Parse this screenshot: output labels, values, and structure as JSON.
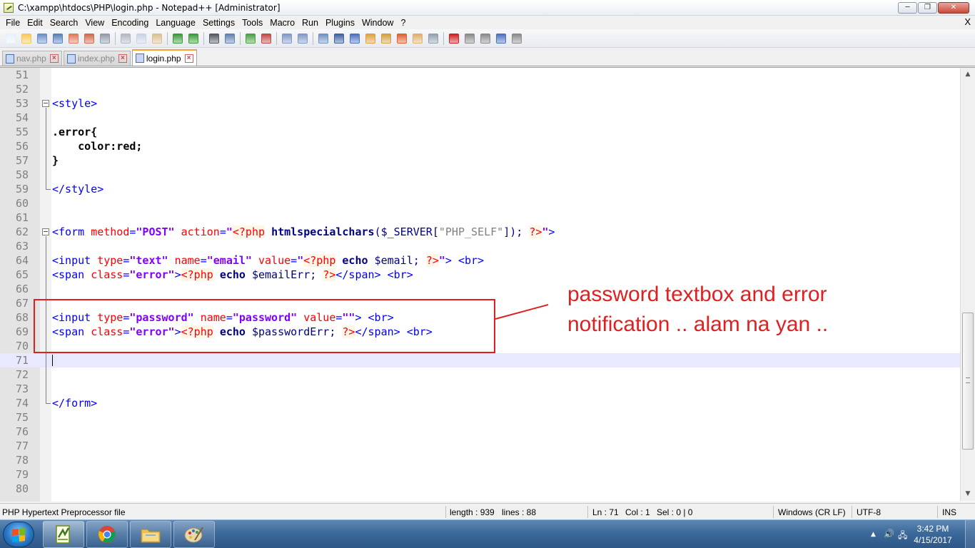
{
  "window": {
    "title": "C:\\xampp\\htdocs\\PHP\\login.php - Notepad++ [Administrator]",
    "min_glyph": "─",
    "max_glyph": "❐",
    "close_glyph": "✕"
  },
  "menu": {
    "items": [
      "File",
      "Edit",
      "Search",
      "View",
      "Encoding",
      "Language",
      "Settings",
      "Tools",
      "Macro",
      "Run",
      "Plugins",
      "Window",
      "?"
    ],
    "close_x": "X"
  },
  "toolbar": {
    "buttons": [
      {
        "name": "new-file-icon",
        "color": "#e8f0ff"
      },
      {
        "name": "open-file-icon",
        "color": "#f6c85a"
      },
      {
        "name": "save-icon",
        "color": "#6a8fc8"
      },
      {
        "name": "save-all-icon",
        "color": "#5a7fb8"
      },
      {
        "name": "close-file-icon",
        "color": "#e07a5a"
      },
      {
        "name": "close-all-icon",
        "color": "#d06a4a"
      },
      {
        "name": "print-icon",
        "color": "#909aa8"
      },
      {
        "sep": true
      },
      {
        "name": "cut-icon",
        "color": "#b0b8c4"
      },
      {
        "name": "copy-icon",
        "color": "#c8d4e4"
      },
      {
        "name": "paste-icon",
        "color": "#d8c090"
      },
      {
        "sep": true
      },
      {
        "name": "undo-icon",
        "color": "#3a9a3a"
      },
      {
        "name": "redo-icon",
        "color": "#3a9a3a"
      },
      {
        "sep": true
      },
      {
        "name": "find-icon",
        "color": "#505860"
      },
      {
        "name": "replace-icon",
        "color": "#6080b0"
      },
      {
        "sep": true
      },
      {
        "name": "zoom-in-icon",
        "color": "#48a048"
      },
      {
        "name": "zoom-out-icon",
        "color": "#c04848"
      },
      {
        "sep": true
      },
      {
        "name": "sync-vertical-icon",
        "color": "#8098c8"
      },
      {
        "name": "sync-horizontal-icon",
        "color": "#8098c8"
      },
      {
        "sep": true
      },
      {
        "name": "word-wrap-icon",
        "color": "#7090c0"
      },
      {
        "name": "show-all-chars-icon",
        "color": "#4060a0"
      },
      {
        "name": "indent-guide-icon",
        "color": "#4a70c0"
      },
      {
        "name": "udl-icon",
        "color": "#e0a040"
      },
      {
        "name": "doc-map-icon",
        "color": "#d0a040"
      },
      {
        "name": "function-list-icon",
        "color": "#e06030"
      },
      {
        "name": "folder-workspace-icon",
        "color": "#e0b070"
      },
      {
        "name": "monitoring-icon",
        "color": "#90a0b0"
      },
      {
        "sep": true
      },
      {
        "name": "record-macro-icon",
        "color": "#d02020"
      },
      {
        "name": "stop-macro-icon",
        "color": "#8a8a8a"
      },
      {
        "name": "play-macro-icon",
        "color": "#8a8a8a"
      },
      {
        "name": "run-macro-multiple-icon",
        "color": "#4a70c0"
      },
      {
        "name": "save-macro-icon",
        "color": "#8a8a8a"
      }
    ]
  },
  "tabs": [
    {
      "label": "nav.php",
      "active": false
    },
    {
      "label": "index.php",
      "active": false
    },
    {
      "label": "login.php",
      "active": true
    }
  ],
  "editor": {
    "current_line": 71,
    "lines": [
      {
        "n": "51",
        "tokens": []
      },
      {
        "n": "52",
        "tokens": []
      },
      {
        "n": "53",
        "tokens": [
          [
            "t-tag",
            "<style>"
          ]
        ]
      },
      {
        "n": "54",
        "tokens": []
      },
      {
        "n": "55",
        "tokens": [
          [
            "t-css-sel",
            ".error{"
          ]
        ]
      },
      {
        "n": "56",
        "tokens": [
          [
            "t-css-sel",
            "    color:red;"
          ]
        ]
      },
      {
        "n": "57",
        "tokens": [
          [
            "t-css-sel",
            "}"
          ]
        ]
      },
      {
        "n": "58",
        "tokens": []
      },
      {
        "n": "59",
        "tokens": [
          [
            "t-tag",
            "</style>"
          ]
        ]
      },
      {
        "n": "60",
        "tokens": []
      },
      {
        "n": "61",
        "tokens": []
      },
      {
        "n": "62",
        "tokens": [
          [
            "t-tag",
            "<form "
          ],
          [
            "t-attr",
            "method"
          ],
          [
            "t-tag",
            "="
          ],
          [
            "t-str",
            "\"POST\""
          ],
          [
            "t-tag",
            " "
          ],
          [
            "t-attr",
            "action"
          ],
          [
            "t-tag",
            "="
          ],
          [
            "t-str",
            "\""
          ],
          [
            "t-php",
            "<?php"
          ],
          [
            "t-plain",
            " "
          ],
          [
            "t-fn",
            "htmlspecialchars"
          ],
          [
            "t-var",
            "($_SERVER["
          ],
          [
            "t-grey",
            "\"PHP_SELF\""
          ],
          [
            "t-var",
            "]); "
          ],
          [
            "t-php",
            "?>"
          ],
          [
            "t-str",
            "\""
          ],
          [
            "t-tag",
            ">"
          ]
        ]
      },
      {
        "n": "63",
        "tokens": []
      },
      {
        "n": "64",
        "tokens": [
          [
            "t-tag",
            "<input "
          ],
          [
            "t-attr",
            "type"
          ],
          [
            "t-tag",
            "="
          ],
          [
            "t-str",
            "\"text\""
          ],
          [
            "t-tag",
            " "
          ],
          [
            "t-attr",
            "name"
          ],
          [
            "t-tag",
            "="
          ],
          [
            "t-str",
            "\"email\""
          ],
          [
            "t-tag",
            " "
          ],
          [
            "t-attr",
            "value"
          ],
          [
            "t-tag",
            "="
          ],
          [
            "t-str",
            "\""
          ],
          [
            "t-php",
            "<?php"
          ],
          [
            "t-plain",
            " "
          ],
          [
            "t-kw",
            "echo"
          ],
          [
            "t-var",
            " $email; "
          ],
          [
            "t-php",
            "?>"
          ],
          [
            "t-str",
            "\""
          ],
          [
            "t-tag",
            "> <br>"
          ]
        ]
      },
      {
        "n": "65",
        "tokens": [
          [
            "t-tag",
            "<span "
          ],
          [
            "t-attr",
            "class"
          ],
          [
            "t-tag",
            "="
          ],
          [
            "t-str",
            "\"error\""
          ],
          [
            "t-tag",
            ">"
          ],
          [
            "t-php",
            "<?php"
          ],
          [
            "t-plain",
            " "
          ],
          [
            "t-kw",
            "echo"
          ],
          [
            "t-var",
            " $emailErr; "
          ],
          [
            "t-php",
            "?>"
          ],
          [
            "t-tag",
            "</span> <br>"
          ]
        ]
      },
      {
        "n": "66",
        "tokens": []
      },
      {
        "n": "67",
        "tokens": []
      },
      {
        "n": "68",
        "tokens": [
          [
            "t-tag",
            "<input "
          ],
          [
            "t-attr",
            "type"
          ],
          [
            "t-tag",
            "="
          ],
          [
            "t-str",
            "\"password\""
          ],
          [
            "t-tag",
            " "
          ],
          [
            "t-attr",
            "name"
          ],
          [
            "t-tag",
            "="
          ],
          [
            "t-str",
            "\"password\""
          ],
          [
            "t-tag",
            " "
          ],
          [
            "t-attr",
            "value"
          ],
          [
            "t-tag",
            "="
          ],
          [
            "t-str",
            "\"\""
          ],
          [
            "t-tag",
            "> <br>"
          ]
        ]
      },
      {
        "n": "69",
        "tokens": [
          [
            "t-tag",
            "<span "
          ],
          [
            "t-attr",
            "class"
          ],
          [
            "t-tag",
            "="
          ],
          [
            "t-str",
            "\"error\""
          ],
          [
            "t-tag",
            ">"
          ],
          [
            "t-php",
            "<?php"
          ],
          [
            "t-plain",
            " "
          ],
          [
            "t-kw",
            "echo"
          ],
          [
            "t-var",
            " $passwordErr; "
          ],
          [
            "t-php",
            "?>"
          ],
          [
            "t-tag",
            "</span> <br>"
          ]
        ]
      },
      {
        "n": "70",
        "tokens": []
      },
      {
        "n": "71",
        "tokens": []
      },
      {
        "n": "72",
        "tokens": []
      },
      {
        "n": "73",
        "tokens": []
      },
      {
        "n": "74",
        "tokens": [
          [
            "t-tag",
            "</form>"
          ]
        ]
      },
      {
        "n": "75",
        "tokens": []
      },
      {
        "n": "76",
        "tokens": []
      },
      {
        "n": "77",
        "tokens": []
      },
      {
        "n": "78",
        "tokens": []
      },
      {
        "n": "79",
        "tokens": []
      },
      {
        "n": "80",
        "tokens": []
      }
    ]
  },
  "annotation": {
    "line1": "password textbox and error",
    "line2": "notification .. alam na yan ..",
    "color": "#e02020"
  },
  "statusbar": {
    "file_type": "PHP Hypertext Preprocessor file",
    "length": "length : 939",
    "lines": "lines : 88",
    "ln": "Ln : 71",
    "col": "Col : 1",
    "sel": "Sel : 0 | 0",
    "eol": "Windows (CR LF)",
    "encoding": "UTF-8",
    "mode": "INS"
  },
  "taskbar": {
    "apps": [
      {
        "name": "notepadpp-taskbar-button",
        "active": true
      },
      {
        "name": "chrome-taskbar-button",
        "active": false
      },
      {
        "name": "explorer-taskbar-button",
        "active": false
      },
      {
        "name": "paint-taskbar-button",
        "active": false
      }
    ],
    "time": "3:42 PM",
    "date": "4/15/2017"
  }
}
